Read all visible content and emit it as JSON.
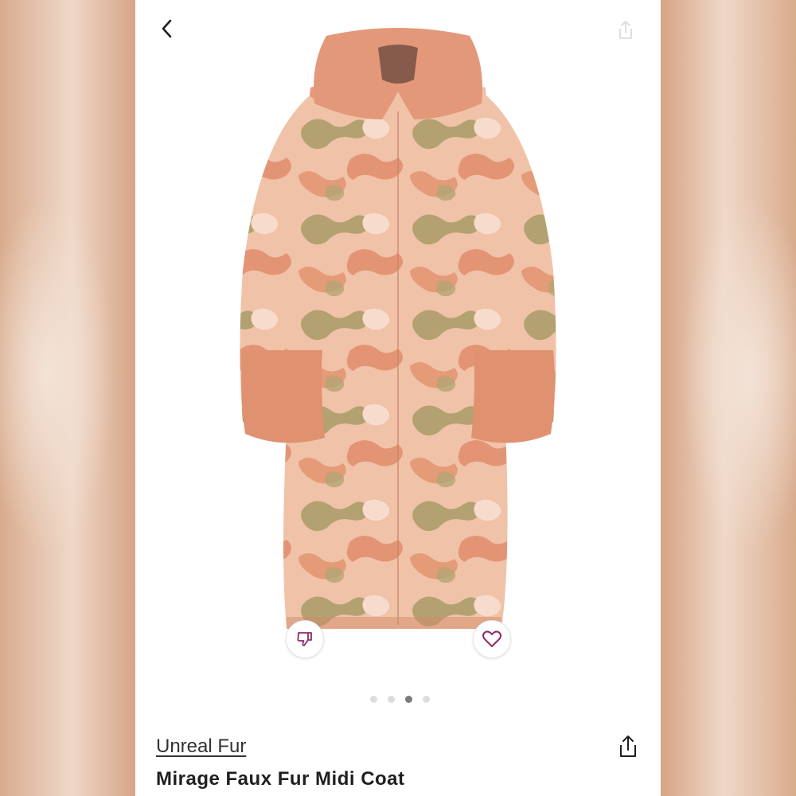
{
  "header": {
    "back_icon": "chevron-left-icon",
    "share_icon": "share-icon"
  },
  "product": {
    "image_desc_colors": {
      "fur_pink": "#e79c7a",
      "fur_light": "#f2c9b2",
      "fur_olive": "#a69a66"
    },
    "brand": "Unreal Fur",
    "title": "Mirage Faux Fur Midi Coat"
  },
  "actions": {
    "dislike_icon": "thumbs-down-icon",
    "like_icon": "heart-icon",
    "accent_color": "#8e2a6b"
  },
  "carousel": {
    "total": 4,
    "active_index": 2
  }
}
